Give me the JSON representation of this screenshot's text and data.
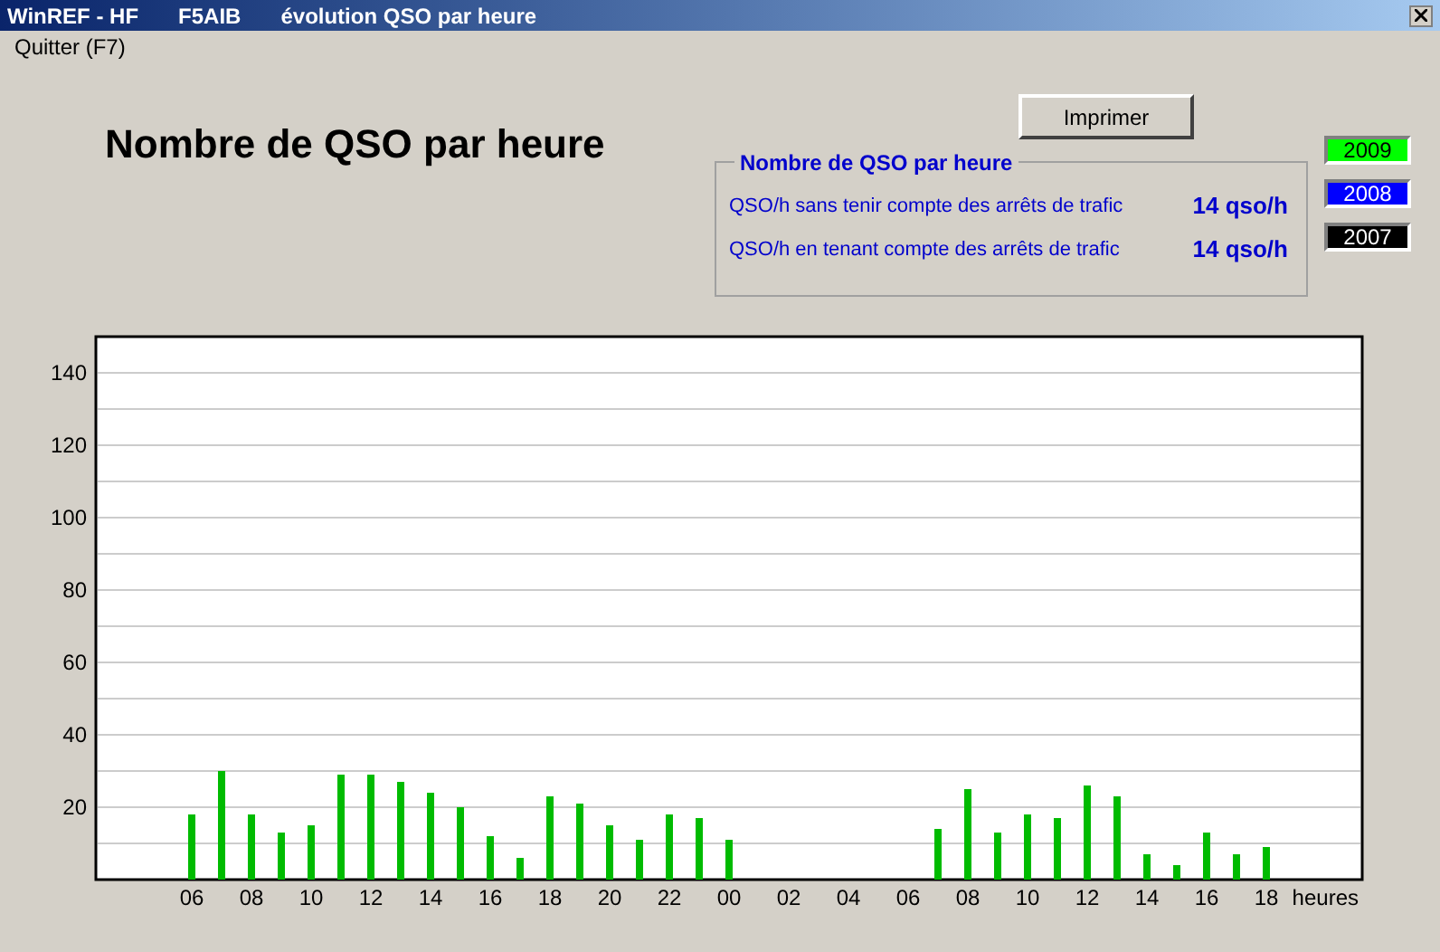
{
  "window": {
    "title_parts": [
      "WinREF - HF",
      "F5AIB",
      "évolution QSO par heure"
    ]
  },
  "menu": [
    "Quitter (F7)"
  ],
  "heading": "Nombre de QSO par heure",
  "print_button": "Imprimer",
  "summary": {
    "title": "Nombre de QSO par heure",
    "rows": [
      {
        "label": "QSO/h sans tenir compte des arrêts de trafic",
        "value": "14 qso/h"
      },
      {
        "label": "QSO/h en tenant compte des arrêts de trafic",
        "value": "14 qso/h"
      }
    ]
  },
  "legend": [
    {
      "label": "2009",
      "color": "#00ff00"
    },
    {
      "label": "2008",
      "color": "#0000ff"
    },
    {
      "label": "2007",
      "color": "#000000"
    }
  ],
  "chart_data": {
    "type": "bar",
    "xlabel": "heures",
    "grid": true,
    "ylim": [
      0,
      150
    ],
    "yticks": [
      20,
      40,
      60,
      80,
      100,
      120,
      140
    ],
    "categories": [
      "06",
      null,
      "08",
      null,
      "10",
      null,
      "12",
      null,
      "14",
      null,
      "16",
      null,
      "18",
      null,
      "20",
      null,
      "22",
      null,
      "00",
      null,
      "02",
      null,
      "04",
      null,
      "06",
      null,
      "08",
      null,
      "10",
      null,
      "12",
      null,
      "14",
      null,
      "16",
      null,
      "18"
    ],
    "series": [
      {
        "color": "#00bb00",
        "values": [
          18,
          30,
          18,
          13,
          15,
          29,
          29,
          27,
          24,
          20,
          12,
          6,
          23,
          21,
          15,
          11,
          18,
          17,
          11,
          null,
          null,
          null,
          null,
          null,
          null,
          14,
          25,
          13,
          18,
          17,
          26,
          23,
          7,
          4,
          13,
          7,
          9
        ]
      }
    ]
  }
}
